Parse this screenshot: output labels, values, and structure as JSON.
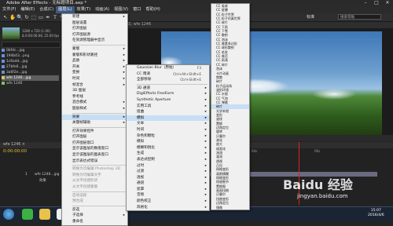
{
  "window": {
    "title": "Adobe After Effects - 无标题项目.aep *",
    "controls": [
      "–",
      "□",
      "✕"
    ]
  },
  "menubar": {
    "items": [
      "文件(F)",
      "编辑(E)",
      "合成(C)",
      "图层(L)",
      "效果(T)",
      "动画(A)",
      "视图(V)",
      "窗口",
      "帮助(H)"
    ],
    "selected_index": 3
  },
  "toolbar": {
    "tools": [
      "↖",
      "✋",
      "🔍",
      "↻",
      "⬚",
      "▭",
      "✒",
      "T",
      "✎",
      "⬡",
      "⌖"
    ],
    "workspace": "标准",
    "search_placeholder": "搜索帮助"
  },
  "project": {
    "comp_meta": [
      "1280 x 720 (1.00)",
      "Δ 0:00:06:06, 25.00 fps"
    ],
    "items": [
      {
        "label": "0bfdc...jpg",
        "color": "#6a8fd8"
      },
      {
        "label": "194b43...png",
        "color": "#6a8fd8"
      },
      {
        "label": "1c6add...jpg",
        "color": "#6a8fd8"
      },
      {
        "label": "27bfe6...jpg",
        "color": "#6a8fd8"
      },
      {
        "label": "3a6f2e...jpg",
        "color": "#6a8fd8"
      },
      {
        "label": "wfe 1246...jpg",
        "color": "#d8c36a"
      },
      {
        "label": "wfe 1246",
        "color": "#7ac46a"
      }
    ],
    "selected_index": 5
  },
  "viewer": {
    "tab": "合成: wfe 1246",
    "status": "50% ▾  完整 ▾"
  },
  "timeline": {
    "tab": "wfe 1246 ×",
    "timecode": "0:00:00:00",
    "ruler": [
      "0s",
      "02s",
      "04s",
      "06s"
    ],
    "layers": [
      {
        "index": "1",
        "name": "wfe 1246...jpg"
      },
      {
        "index": "",
        "name": "效果"
      }
    ]
  },
  "menu_layer": {
    "items": [
      {
        "label": "新建",
        "arrow": true
      },
      {
        "label": "图层设置",
        "arrow": false
      },
      {
        "label": "打开图层",
        "arrow": false
      },
      {
        "label": "打开图层源",
        "arrow": false
      },
      {
        "label": "在资源管理器中显示",
        "arrow": false
      },
      {
        "sep": true
      },
      {
        "label": "蒙版",
        "arrow": true
      },
      {
        "label": "蒙版和形状路径",
        "arrow": true
      },
      {
        "label": "品质",
        "arrow": true
      },
      {
        "label": "开关",
        "arrow": true
      },
      {
        "label": "变换",
        "arrow": true
      },
      {
        "label": "时间",
        "arrow": true
      },
      {
        "label": "帧混合",
        "arrow": true
      },
      {
        "label": "3D 图层",
        "arrow": false
      },
      {
        "label": "参考线",
        "arrow": false
      },
      {
        "label": "混合模式",
        "arrow": true
      },
      {
        "label": "图层样式",
        "arrow": true
      },
      {
        "sep": true
      },
      {
        "label": "效果",
        "arrow": true,
        "hl": true
      },
      {
        "label": "关键帧辅助",
        "arrow": true
      },
      {
        "sep": true
      },
      {
        "label": "打开效果控件",
        "arrow": false
      },
      {
        "label": "打开图层",
        "arrow": false
      },
      {
        "label": "打开图层窗口",
        "arrow": false
      },
      {
        "label": "显示该图层的数值窗口",
        "arrow": false
      },
      {
        "label": "显示该图层的图表窗口",
        "arrow": false
      },
      {
        "label": "显示表达式错误",
        "arrow": false
      },
      {
        "sep": true
      },
      {
        "label": "转换为可编辑 Photoshop 3D",
        "arrow": false,
        "dis": true
      },
      {
        "label": "转换为可编辑文字",
        "arrow": false,
        "dis": true
      },
      {
        "label": "从文字创建形状",
        "arrow": false,
        "dis": true
      },
      {
        "label": "从文字创建蒙版",
        "arrow": false,
        "dis": true
      },
      {
        "sep": true
      },
      {
        "label": "自动追踪",
        "arrow": false,
        "dis": true
      },
      {
        "label": "预合成",
        "arrow": false,
        "dis": true
      },
      {
        "sep": true
      },
      {
        "label": "反选",
        "arrow": false
      },
      {
        "label": "子选择",
        "arrow": true
      },
      {
        "label": "重命名",
        "arrow": false
      }
    ]
  },
  "menu_effect": {
    "items": [
      {
        "label": "Gaussian Blur（原始）",
        "sc": "F3"
      },
      {
        "label": "CC 雨滴",
        "sc": "Ctrl+Alt+Shift+E"
      },
      {
        "label": "全部移除",
        "sc": "Ctrl+Shift+E"
      },
      {
        "sep": true
      },
      {
        "label": "3D 通道",
        "arrow": true
      },
      {
        "label": "DigiEffects FreeForm",
        "arrow": true
      },
      {
        "label": "Synthetic Aperture",
        "arrow": true
      },
      {
        "label": "实用工具",
        "arrow": true
      },
      {
        "label": "扭曲",
        "arrow": true
      },
      {
        "label": "模拟",
        "arrow": true,
        "hl": true
      },
      {
        "label": "文本",
        "arrow": true
      },
      {
        "label": "时间",
        "arrow": true
      },
      {
        "label": "杂色和颗粒",
        "arrow": true
      },
      {
        "label": "模拟",
        "arrow": true
      },
      {
        "label": "模糊和锐化",
        "arrow": true
      },
      {
        "label": "生成",
        "arrow": true
      },
      {
        "label": "表达式控制",
        "arrow": true
      },
      {
        "label": "过时",
        "arrow": true
      },
      {
        "label": "过渡",
        "arrow": true
      },
      {
        "label": "透视",
        "arrow": true
      },
      {
        "label": "通道",
        "arrow": true
      },
      {
        "label": "遮罩",
        "arrow": true
      },
      {
        "label": "音频",
        "arrow": true
      },
      {
        "label": "颜色校正",
        "arrow": true
      },
      {
        "label": "风格化",
        "arrow": true
      }
    ]
  },
  "menu_simulate": {
    "items": [
      {
        "label": "CC 吸收"
      },
      {
        "label": "CC 星爆"
      },
      {
        "label": "CC 粒子世界"
      },
      {
        "label": "CC 粒子仿真世界"
      },
      {
        "label": "CC 碎片"
      },
      {
        "label": "CC 下雨"
      },
      {
        "label": "CC 下雪"
      },
      {
        "label": "CC 散射"
      },
      {
        "label": "CC 泡沫"
      },
      {
        "label": "CC 像素多边形"
      },
      {
        "label": "CC 球形散射"
      },
      {
        "label": "CC 毛发"
      },
      {
        "label": "CC 卷页"
      },
      {
        "label": "CC 雨滴"
      },
      {
        "label": "CC 碎片"
      },
      {
        "label": "泡沫"
      },
      {
        "label": "卡片动画"
      },
      {
        "label": "焦散"
      },
      {
        "label": "碎片"
      },
      {
        "label": "粒子运动场"
      },
      {
        "label": "波形环境"
      },
      {
        "label": "CC 水银"
      },
      {
        "label": "CC 气泡"
      },
      {
        "label": "CC 弹跳"
      },
      {
        "label": "碎片",
        "hl": true
      },
      {
        "label": "光学补偿"
      },
      {
        "label": "变形"
      },
      {
        "label": "波纹"
      },
      {
        "label": "置换"
      },
      {
        "label": "边角定位"
      },
      {
        "label": "旋转"
      },
      {
        "label": "贝塞尔"
      },
      {
        "label": "液化"
      },
      {
        "label": "放大"
      },
      {
        "label": "球面化"
      },
      {
        "label": "湍流"
      },
      {
        "label": "漩涡"
      },
      {
        "label": "透视"
      },
      {
        "label": "凸出"
      },
      {
        "label": "网格变形"
      },
      {
        "label": "高斯模糊"
      },
      {
        "label": "网格变形"
      },
      {
        "label": "保留细节"
      },
      {
        "label": "置换图"
      },
      {
        "label": "画面扭曲"
      },
      {
        "label": "贝塞尔"
      },
      {
        "label": "扭曲变形"
      },
      {
        "label": "边角定位"
      },
      {
        "label": "镜像"
      }
    ]
  },
  "taskbar": {
    "time": "15:07",
    "date": "2016/4/6"
  },
  "watermark": {
    "logo": "Baidu 经验",
    "url": "jingyan.baidu.com"
  }
}
